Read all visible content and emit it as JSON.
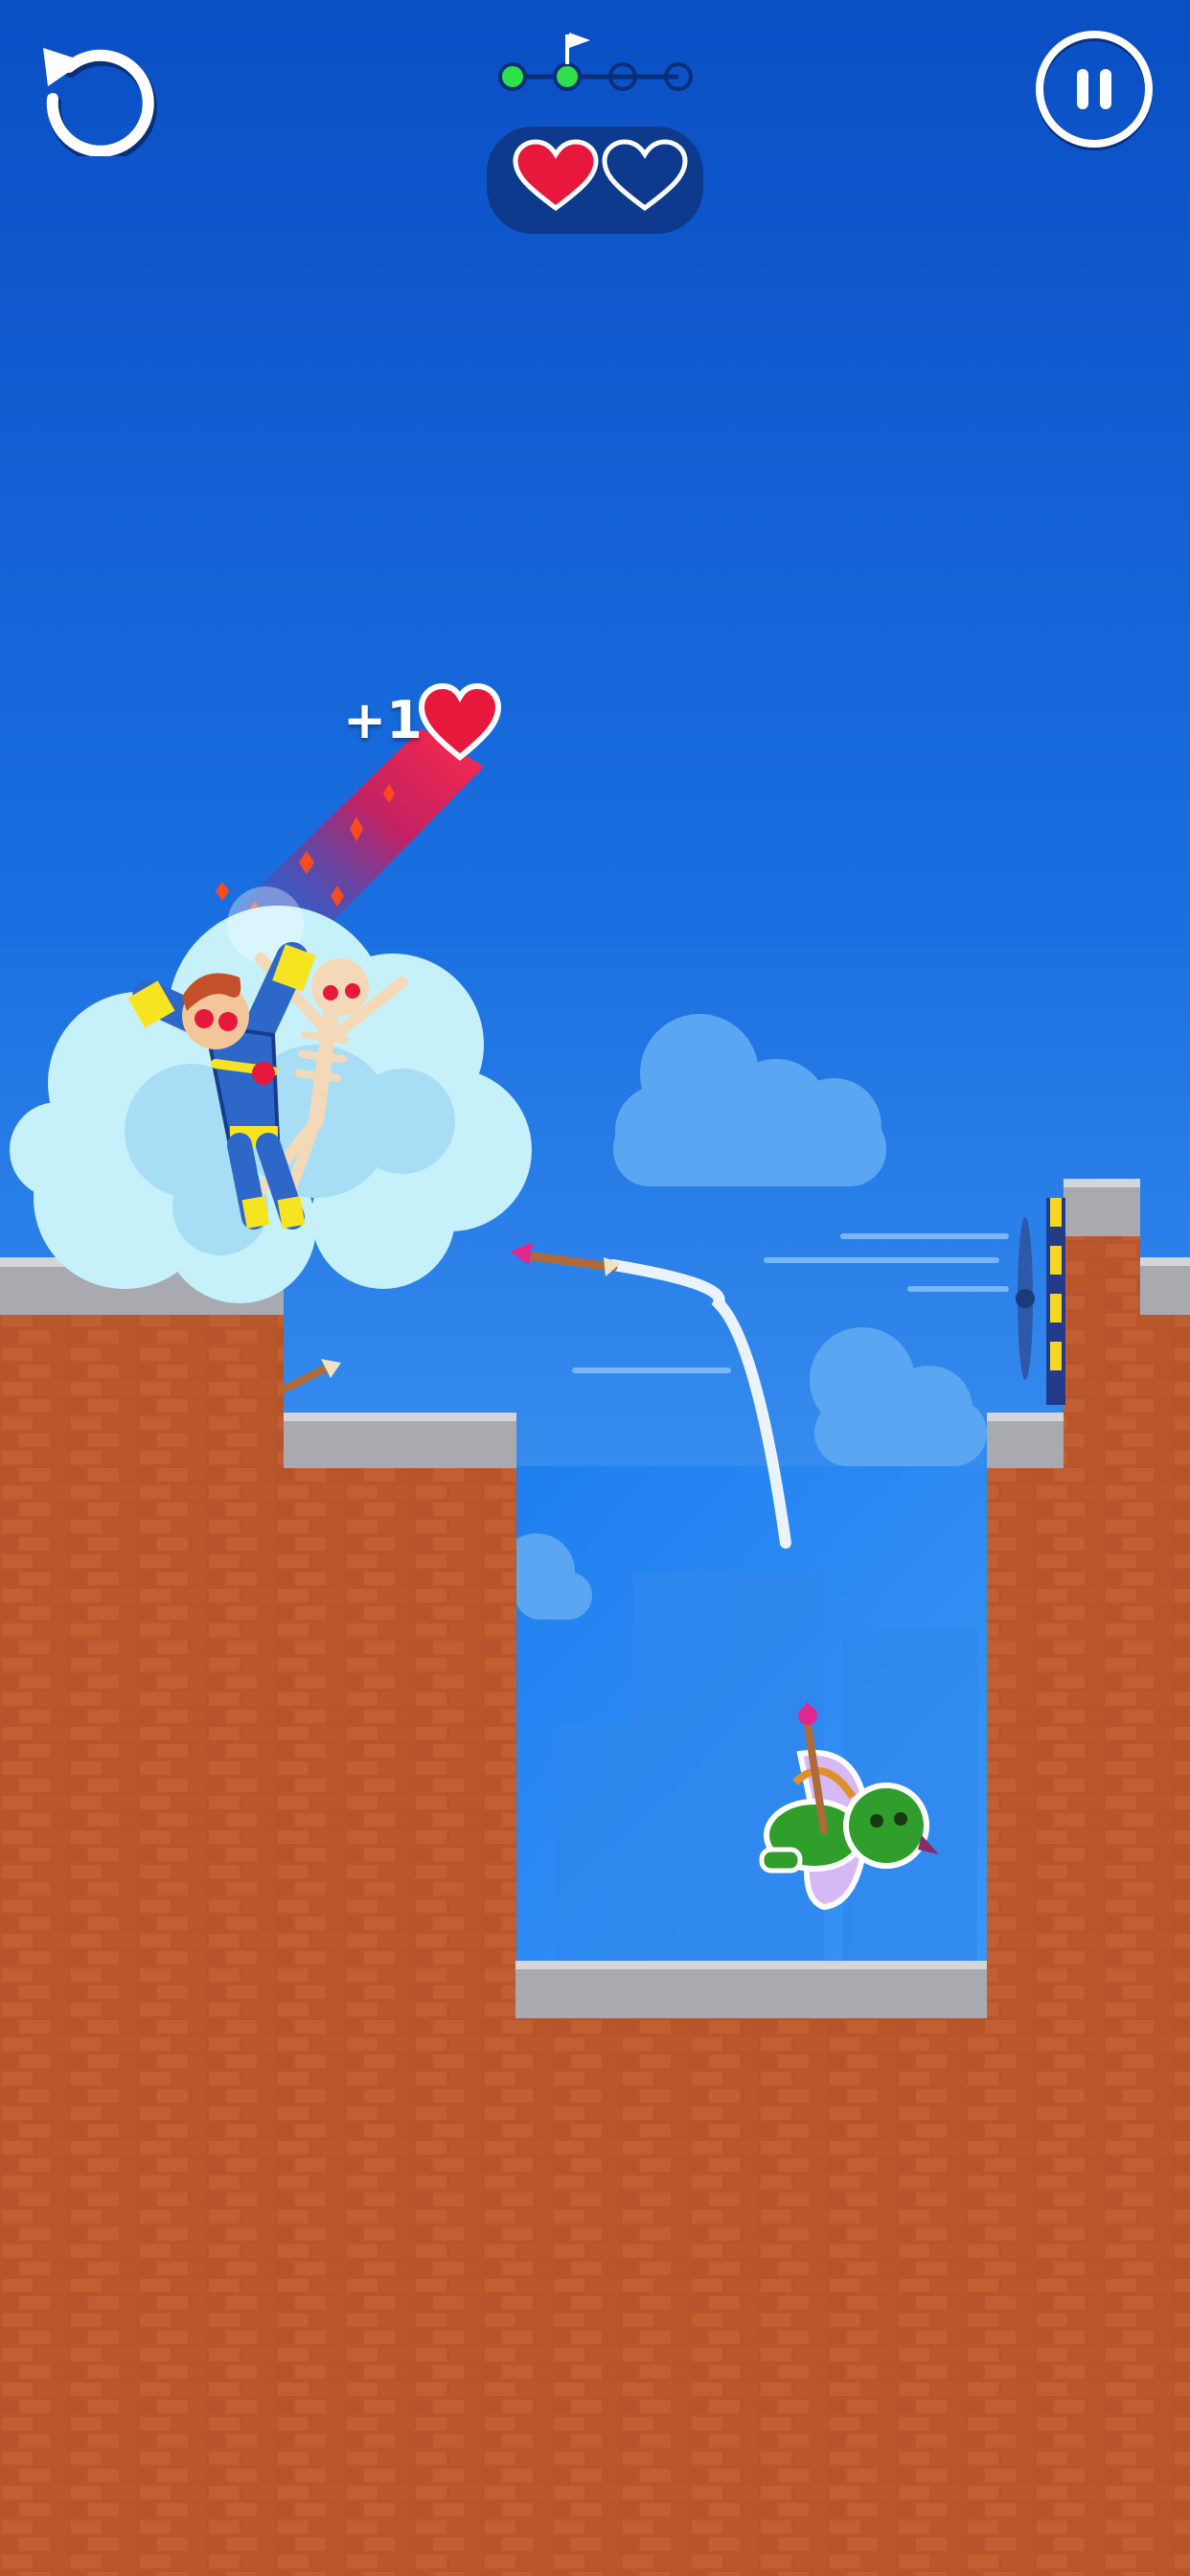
{
  "hud": {
    "restart_icon": "restart-icon",
    "pause_icon": "pause-icon",
    "level_progress": {
      "total_stages": 4,
      "completed_stages": 2,
      "current_stage_flag": "flag-icon"
    },
    "lives": {
      "total": 2,
      "filled": 1
    }
  },
  "popup": {
    "text": "+1",
    "icon": "heart-icon"
  },
  "colors": {
    "sky_top": "#0a4fc4",
    "brick": "#b8552a",
    "stone": "#a8aab0",
    "progress_done": "#2ee04a",
    "heart": "#e8173c"
  }
}
